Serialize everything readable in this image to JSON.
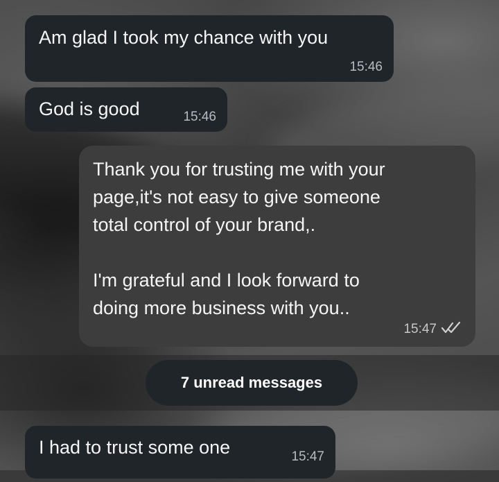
{
  "messages": [
    {
      "direction": "incoming",
      "text": "Am glad I took my chance with you",
      "time": "15:46"
    },
    {
      "direction": "incoming",
      "text": "God is good",
      "time": "15:46"
    },
    {
      "direction": "outgoing",
      "text": "Thank you for trusting me with your\npage,it's not easy to give someone\ntotal control of your brand,.\n\nI'm grateful and I look forward to\ndoing more business with you..",
      "time": "15:47",
      "status_icon": "double-check-icon"
    },
    {
      "direction": "incoming",
      "text": "I had to trust some one",
      "time": "15:47"
    }
  ],
  "unread_banner": {
    "label": "7 unread messages"
  },
  "colors": {
    "incoming_bubble": "#1f2529",
    "outgoing_bubble": "#3d3d3d",
    "timestamp": "#b5bdc2",
    "text": "#ffffff"
  }
}
